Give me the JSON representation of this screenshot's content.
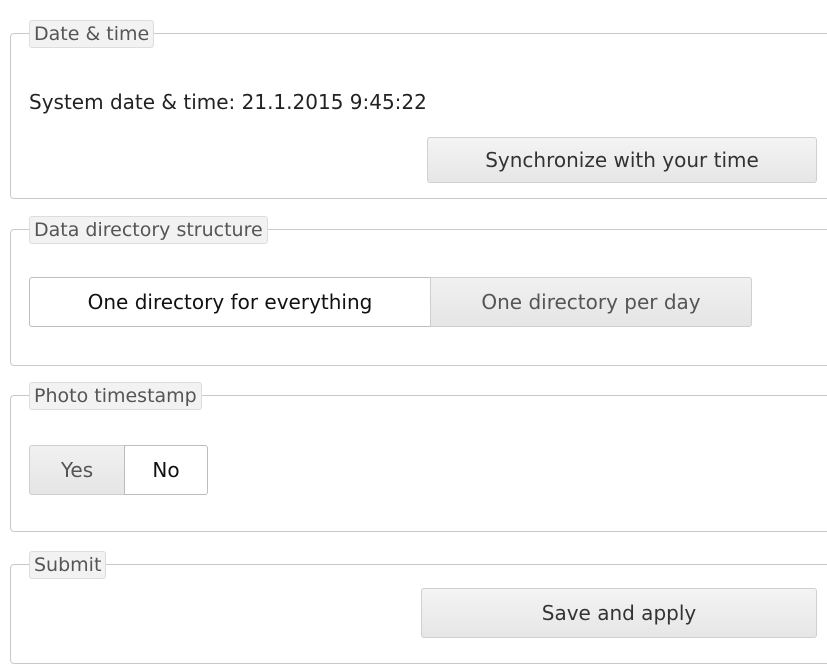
{
  "date_time": {
    "legend": "Date & time",
    "system_time_label": "System date & time: 21.1.2015 9:45:22",
    "sync_button": "Synchronize with your time"
  },
  "directory_structure": {
    "legend": "Data directory structure",
    "options": [
      {
        "label": "One directory for everything",
        "selected": true
      },
      {
        "label": "One directory per day",
        "selected": false
      }
    ]
  },
  "photo_timestamp": {
    "legend": "Photo timestamp",
    "options": [
      {
        "label": "Yes",
        "selected": false
      },
      {
        "label": "No",
        "selected": true
      }
    ]
  },
  "submit": {
    "legend": "Submit",
    "save_button": "Save and apply"
  }
}
